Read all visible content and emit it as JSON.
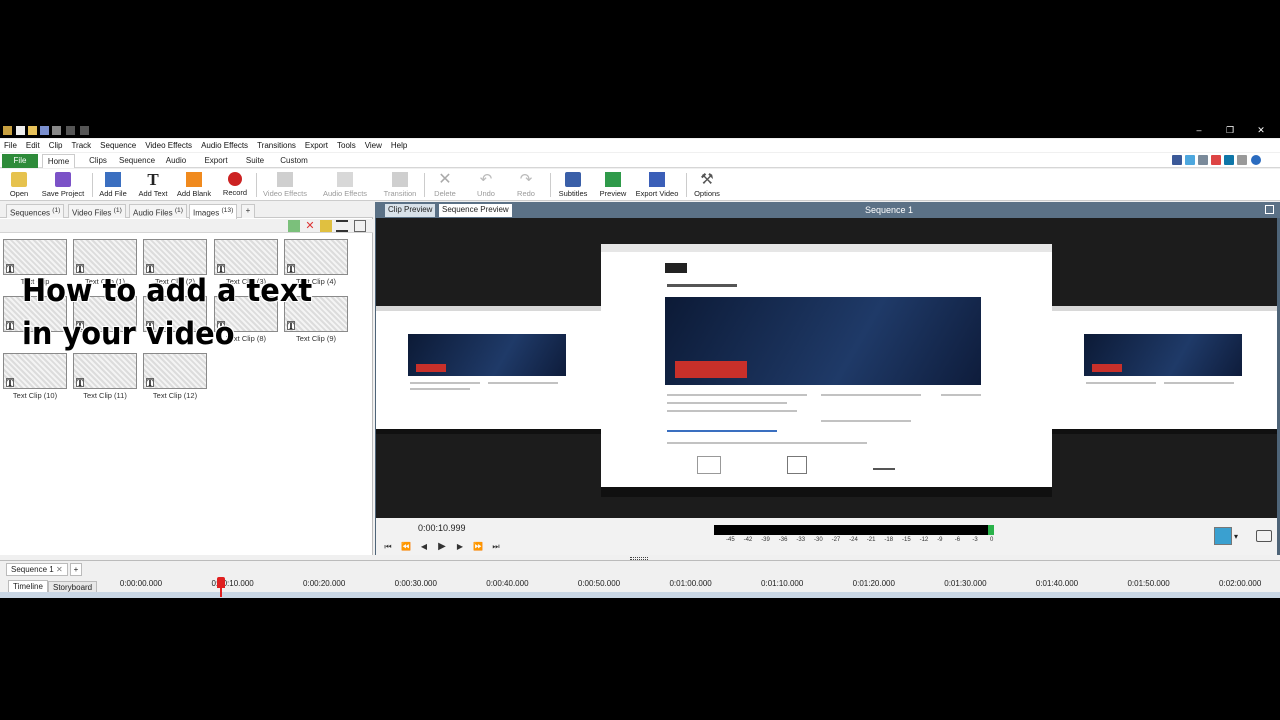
{
  "menu": [
    "File",
    "Edit",
    "Clip",
    "Track",
    "Sequence",
    "Video Effects",
    "Audio Effects",
    "Transitions",
    "Export",
    "Tools",
    "View",
    "Help"
  ],
  "ribbon_tabs": [
    "File",
    "Home",
    "Clips",
    "Sequence",
    "Audio",
    "Export",
    "Suite",
    "Custom"
  ],
  "toolbar": {
    "open": "Open",
    "save_project": "Save Project",
    "add_file": "Add File",
    "add_text": "Add Text",
    "add_blank": "Add Blank",
    "record": "Record",
    "video_effects": "Video Effects",
    "audio_effects": "Audio Effects",
    "transition": "Transition",
    "delete": "Delete",
    "undo": "Undo",
    "redo": "Redo",
    "subtitles": "Subtitles",
    "preview": "Preview",
    "export_video": "Export Video",
    "options": "Options"
  },
  "bin_tabs": [
    {
      "label": "Sequences",
      "count": "(1)"
    },
    {
      "label": "Video Files",
      "count": "(1)"
    },
    {
      "label": "Audio Files",
      "count": "(1)"
    },
    {
      "label": "Images",
      "count": "(13)"
    }
  ],
  "clips": [
    "Text Clip",
    "Text Clip (1)",
    "Text Clip (2)",
    "Text Clip (3)",
    "Text Clip (4)",
    "",
    "",
    "",
    "Text Clip (8)",
    "Text Clip (9)",
    "Text Clip (10)",
    "Text Clip (11)",
    "Text Clip (12)"
  ],
  "overlay": {
    "line1": "How to add a text",
    "line2": "in your video"
  },
  "preview": {
    "clip_tab": "Clip Preview",
    "sequence_tab": "Sequence Preview",
    "title": "Sequence 1",
    "time": "0:00:10.999",
    "meter_labels": [
      "-45",
      "-42",
      "-39",
      "-36",
      "-33",
      "-30",
      "-27",
      "-24",
      "-21",
      "-18",
      "-15",
      "-12",
      "-9",
      "-6",
      "-3",
      "0"
    ]
  },
  "sequence": {
    "tab": "Sequence 1",
    "timeline_btn": "Timeline",
    "storyboard_btn": "Storyboard",
    "ruler": [
      "0:00:00.000",
      "0:00:10.000",
      "0:00:20.000",
      "0:00:30.000",
      "0:00:40.000",
      "0:00:50.000",
      "0:01:00.000",
      "0:01:10.000",
      "0:01:20.000",
      "0:01:30.000",
      "0:01:40.000",
      "0:01:50.000",
      "0:02:00.000"
    ]
  },
  "colors": {
    "accent_green": "#2e8b3a",
    "preview_bg": "#4e6478",
    "playhead": "#e02020"
  }
}
